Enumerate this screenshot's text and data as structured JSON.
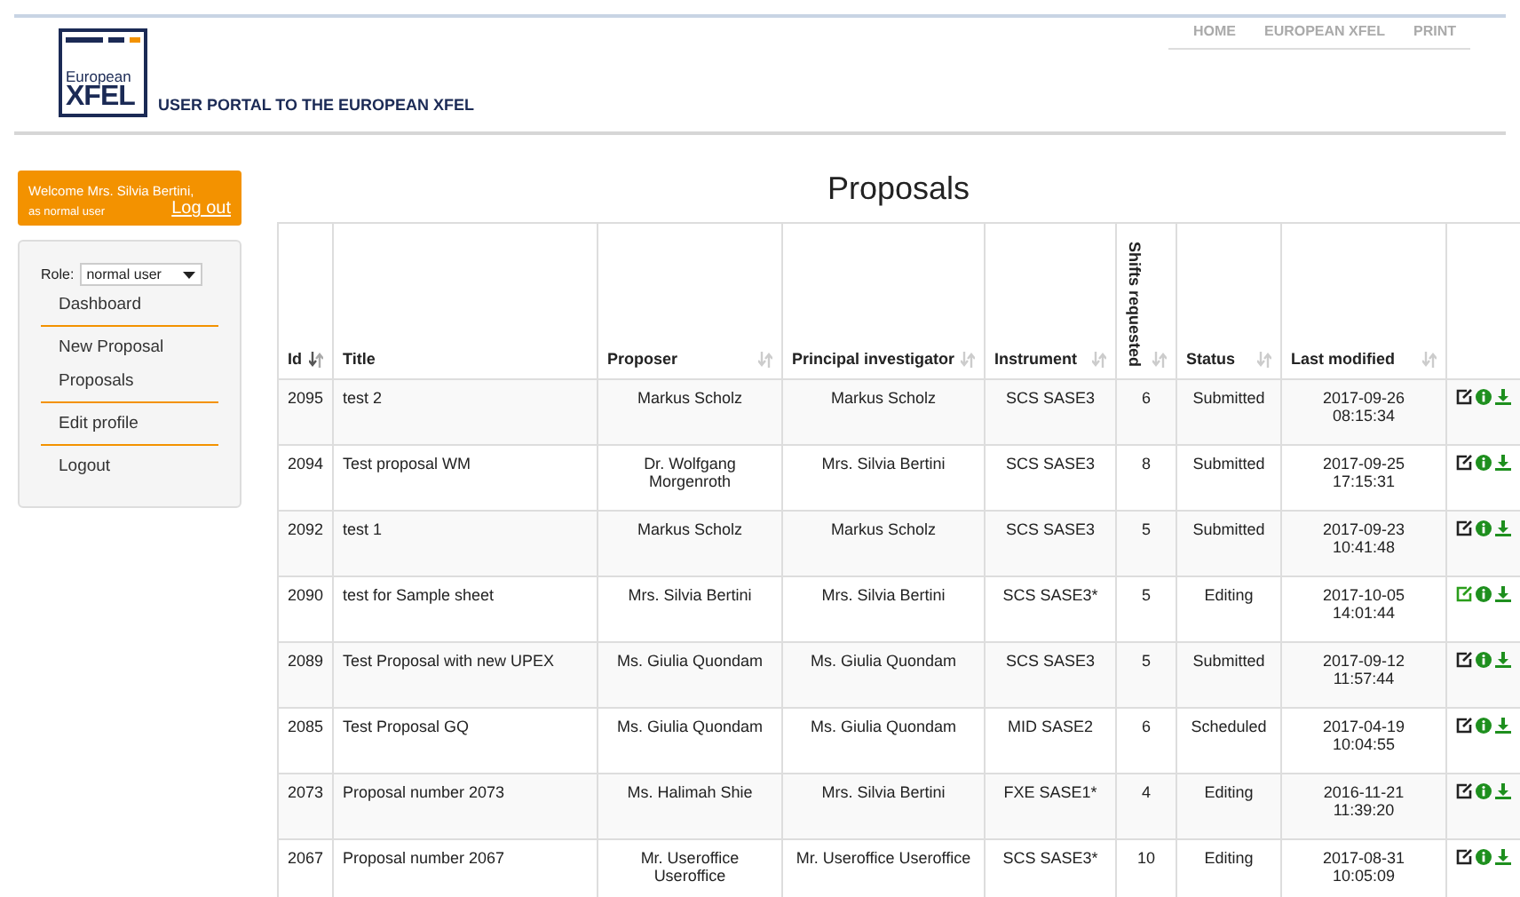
{
  "header": {
    "logo_top": "European",
    "logo_bottom": "XFEL",
    "tagline": "USER PORTAL TO THE EUROPEAN XFEL",
    "nav": [
      "HOME",
      "EUROPEAN XFEL",
      "PRINT"
    ]
  },
  "welcome": {
    "greeting": "Welcome Mrs. Silvia Bertini,",
    "role_note": "as normal user",
    "logout_link": "Log out"
  },
  "sidebar": {
    "role_label": "Role:",
    "role_value": "normal user",
    "items": [
      {
        "label": "Dashboard",
        "divider": true
      },
      {
        "label": "New Proposal",
        "divider": false
      },
      {
        "label": "Proposals",
        "divider": true
      },
      {
        "label": "Edit profile",
        "divider": true
      },
      {
        "label": "Logout",
        "divider": false
      }
    ]
  },
  "page_title": "Proposals",
  "table": {
    "columns": [
      {
        "label": "Id",
        "sorted": true
      },
      {
        "label": "Title"
      },
      {
        "label": "Proposer",
        "sorted": false
      },
      {
        "label": "Principal investigator",
        "sorted": false
      },
      {
        "label": "Instrument",
        "sorted": false
      },
      {
        "label": "Shifts requested",
        "sorted": false,
        "vertical": true
      },
      {
        "label": "Status",
        "sorted": false
      },
      {
        "label": "Last modified",
        "sorted": false
      }
    ],
    "rows": [
      {
        "cells": [
          "2095",
          "test 2",
          "Markus Scholz",
          "Markus Scholz",
          "SCS SASE3",
          "6",
          "Submitted",
          "2017-09-26 08:15:34"
        ],
        "edit_highlighted": false
      },
      {
        "cells": [
          "2094",
          "Test proposal WM",
          "Dr. Wolfgang Morgenroth",
          "Mrs. Silvia Bertini",
          "SCS SASE3",
          "8",
          "Submitted",
          "2017-09-25 17:15:31"
        ],
        "edit_highlighted": false
      },
      {
        "cells": [
          "2092",
          "test 1",
          "Markus Scholz",
          "Markus Scholz",
          "SCS SASE3",
          "5",
          "Submitted",
          "2017-09-23 10:41:48"
        ],
        "edit_highlighted": false
      },
      {
        "cells": [
          "2090",
          "test for Sample sheet",
          "Mrs. Silvia Bertini",
          "Mrs. Silvia Bertini",
          "SCS SASE3*",
          "5",
          "Editing",
          "2017-10-05 14:01:44"
        ],
        "edit_highlighted": true
      },
      {
        "cells": [
          "2089",
          "Test Proposal with new UPEX",
          "Ms. Giulia Quondam",
          "Ms. Giulia Quondam",
          "SCS SASE3",
          "5",
          "Submitted",
          "2017-09-12 11:57:44"
        ],
        "edit_highlighted": false
      },
      {
        "cells": [
          "2085",
          "Test Proposal GQ",
          "Ms. Giulia Quondam",
          "Ms. Giulia Quondam",
          "MID SASE2",
          "6",
          "Scheduled",
          "2017-04-19 10:04:55"
        ],
        "edit_highlighted": false
      },
      {
        "cells": [
          "2073",
          "Proposal number 2073",
          "Ms. Halimah Shie",
          "Mrs. Silvia Bertini",
          "FXE SASE1*",
          "4",
          "Editing",
          "2016-11-21 11:39:20"
        ],
        "edit_highlighted": false
      },
      {
        "cells": [
          "2067",
          "Proposal number 2067",
          "Mr. Useroffice Useroffice",
          "Mr. Useroffice Useroffice",
          "SCS SASE3*",
          "10",
          "Editing",
          "2017-08-31 10:05:09"
        ],
        "edit_highlighted": false
      }
    ]
  }
}
